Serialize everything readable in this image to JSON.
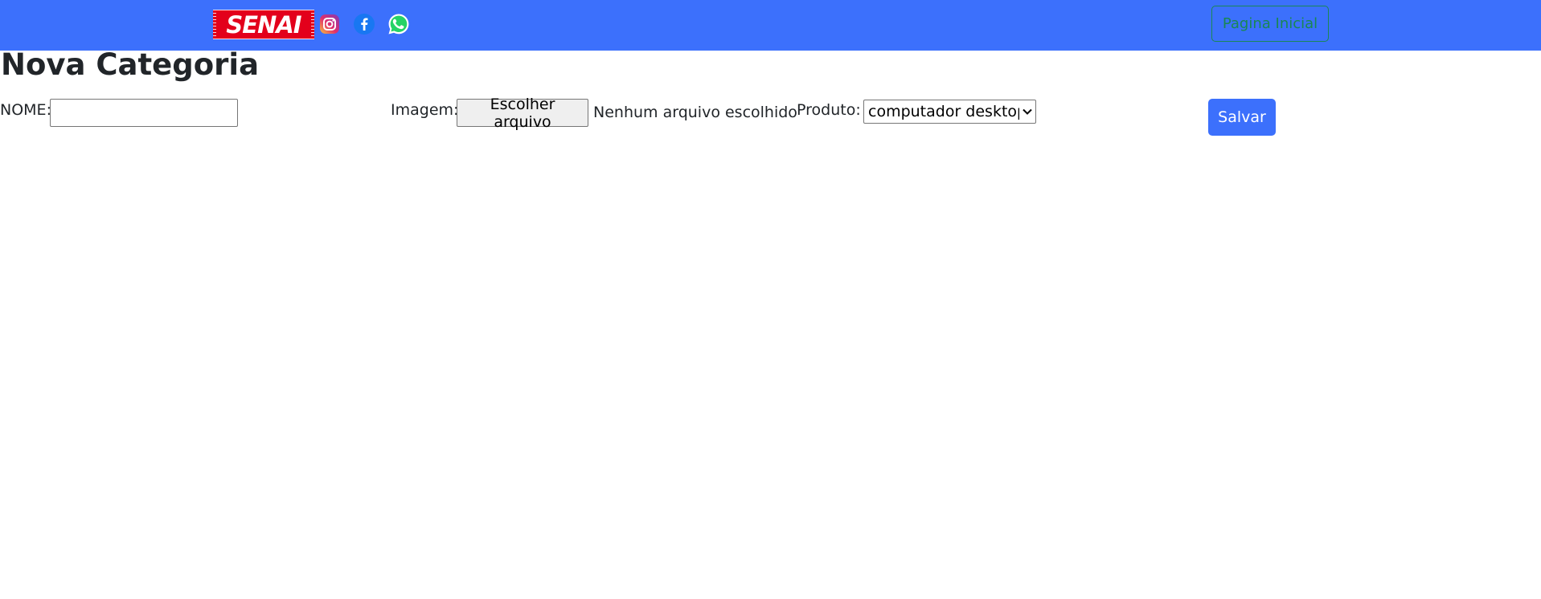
{
  "header": {
    "logo_text": "SENAI",
    "social_icons": [
      "instagram-icon",
      "facebook-icon",
      "whatsapp-icon"
    ],
    "nav_button_label": "Pagina Inicial",
    "colors": {
      "bar": "#3c70fc",
      "logo_red": "#e3001b",
      "nav_button": "#198754"
    }
  },
  "page": {
    "title": "Nova Categoria"
  },
  "form": {
    "nome_label": "NOME:",
    "nome_value": "",
    "imagem_label": "Imagem:",
    "file_button_label": "Escolher arquivo",
    "file_status": "Nenhum arquivo escolhido",
    "produto_label": "Produto:",
    "produto_selected": "computador desktop",
    "save_label": "Salvar",
    "save_color": "#3c70fc"
  }
}
